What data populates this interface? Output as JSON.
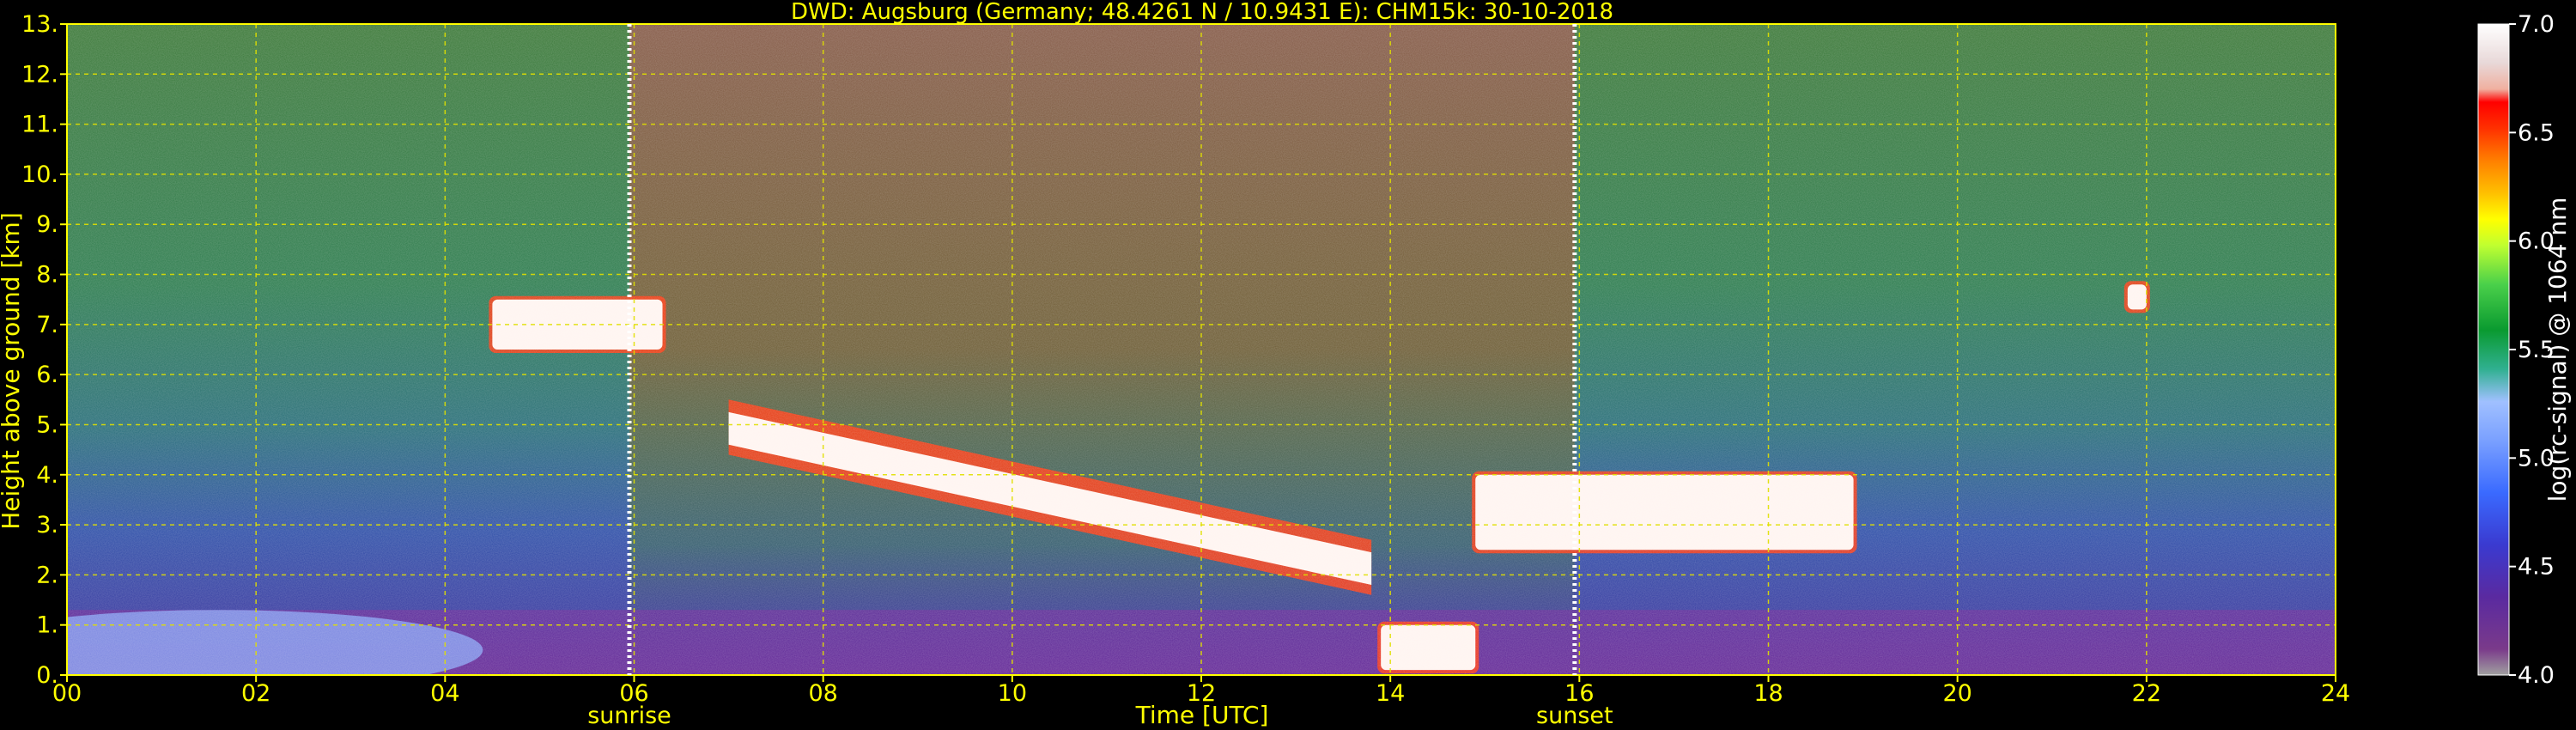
{
  "chart_data": {
    "type": "heatmap",
    "title": "DWD: Augsburg (Germany; 48.4261 N / 10.9431 E):    CHM15k: 30-10-2018",
    "xlabel": "Time [UTC]",
    "ylabel": "Height above ground [km]",
    "xlim": [
      0,
      24
    ],
    "ylim": [
      0,
      13
    ],
    "x_ticks": [
      "00",
      "02",
      "04",
      "06",
      "08",
      "10",
      "12",
      "14",
      "16",
      "18",
      "20",
      "22",
      "24"
    ],
    "y_ticks": [
      "0.",
      "1.",
      "2.",
      "3.",
      "4.",
      "5.",
      "6.",
      "7.",
      "8.",
      "9.",
      "10.",
      "11.",
      "12.",
      "13."
    ],
    "grid": true,
    "annotations": [
      {
        "label": "sunrise",
        "time_utc": 5.95
      },
      {
        "label": "sunset",
        "time_utc": 15.95
      }
    ],
    "colorbar": {
      "label": "log(rc-signal) @ 1064 nm",
      "range": [
        4.0,
        7.0
      ],
      "ticks": [
        "4.0",
        "4.5",
        "5.0",
        "5.5",
        "6.0",
        "6.5",
        "7.0"
      ]
    },
    "features": [
      {
        "name": "aerosol boundary layer",
        "t0": 0,
        "t1": 24,
        "h0": 0.0,
        "h1": 1.3
      },
      {
        "name": "cloud layer early",
        "t0": 4.5,
        "t1": 6.3,
        "h0": 6.5,
        "h1": 7.5
      },
      {
        "name": "descending cloud",
        "t0": 7,
        "t1": 13.8,
        "h_start": 4.8,
        "h_end": 2.0
      },
      {
        "name": "low cloud",
        "t0": 13.9,
        "t1": 14.9,
        "h0": 0.1,
        "h1": 1.0
      },
      {
        "name": "evening cloud",
        "t0": 14.9,
        "t1": 18.9,
        "h0": 2.5,
        "h1": 4.0
      },
      {
        "name": "isolated patch",
        "t0": 21.8,
        "t1": 22.0,
        "h0": 7.3,
        "h1": 7.8
      }
    ]
  }
}
